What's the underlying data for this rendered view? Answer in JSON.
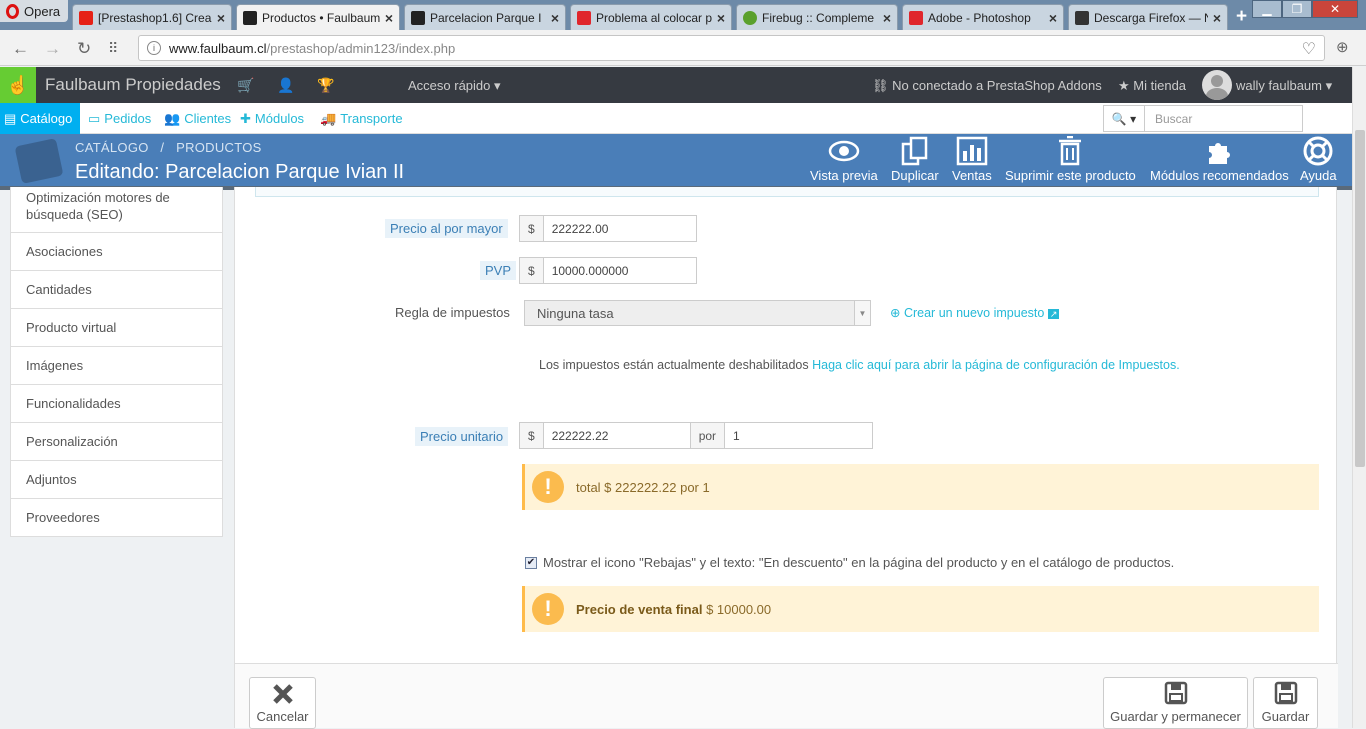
{
  "browser": {
    "menu_label": "Opera",
    "tabs": [
      {
        "title": "[Prestashop1.6] Crea",
        "favicon_color": "#e62117"
      },
      {
        "title": "Productos • Faulbaum",
        "favicon_color": "#222222"
      },
      {
        "title": "Parcelacion Parque I",
        "favicon_color": "#222222"
      },
      {
        "title": "Problema al colocar p",
        "favicon_color": "#e0262c"
      },
      {
        "title": "Firebug :: Compleme",
        "favicon_color": "#5aa02c"
      },
      {
        "title": "Adobe - Photoshop",
        "favicon_color": "#e0262c"
      },
      {
        "title": "Descarga Firefox — N",
        "favicon_color": "#333333"
      }
    ],
    "url_domain": "www.faulbaum.cl",
    "url_path": "/prestashop/admin123/index.php"
  },
  "header": {
    "shop_name": "Faulbaum Propiedades",
    "quick_access": "Acceso rápido",
    "addons_status": "No conectado a PrestaShop Addons",
    "my_store": "Mi tienda",
    "user_name": "wally faulbaum"
  },
  "menu": {
    "items": [
      "Catálogo",
      "Pedidos",
      "Clientes",
      "Módulos",
      "Transporte"
    ],
    "search_placeholder": "Buscar"
  },
  "toolbar": {
    "breadcrumb_1": "CATÁLOGO",
    "breadcrumb_sep": "/",
    "breadcrumb_2": "PRODUCTOS",
    "title": "Editando: Parcelacion Parque Ivian II",
    "buttons": [
      "Vista previa",
      "Duplicar",
      "Ventas",
      "Suprimir este producto",
      "Módulos recomendados",
      "Ayuda"
    ]
  },
  "sidebar": {
    "items": [
      "Optimización motores de búsqueda (SEO)",
      "Asociaciones",
      "Cantidades",
      "Producto virtual",
      "Imágenes",
      "Funcionalidades",
      "Personalización",
      "Adjuntos",
      "Proveedores"
    ]
  },
  "form": {
    "wholesale_label": "Precio al por mayor",
    "wholesale_currency": "$",
    "wholesale_value": "222222.00",
    "pvp_label": "PVP",
    "pvp_currency": "$",
    "pvp_value": "10000.000000",
    "tax_label": "Regla de impuestos",
    "tax_value": "Ninguna tasa",
    "new_tax_link": "Crear un nuevo impuesto",
    "tax_notice": "Los impuestos están actualmente deshabilitados",
    "tax_notice_link": "Haga clic aquí para abrir la página de configuración de Impuestos.",
    "unit_label": "Precio unitario",
    "unit_currency": "$",
    "unit_value": "222222.22",
    "unit_per": "por",
    "unit_qty": "1",
    "unit_total": "total $ 222222.22 por 1",
    "on_sale_checked": true,
    "on_sale_text": "Mostrar el icono \"Rebajas\" y el texto: \"En descuento\" en la página del producto y en el catálogo de productos.",
    "final_price_label": "Precio de venta final",
    "final_price_value": "$ 10000.00"
  },
  "footer": {
    "cancel": "Cancelar",
    "save_stay": "Guardar y permanecer",
    "save": "Guardar"
  },
  "colors": {
    "toolbar_bg": "#4a7eb8",
    "header_bg": "#363a41",
    "accent": "#25b9d7",
    "warning_bg": "#fff3d7"
  }
}
